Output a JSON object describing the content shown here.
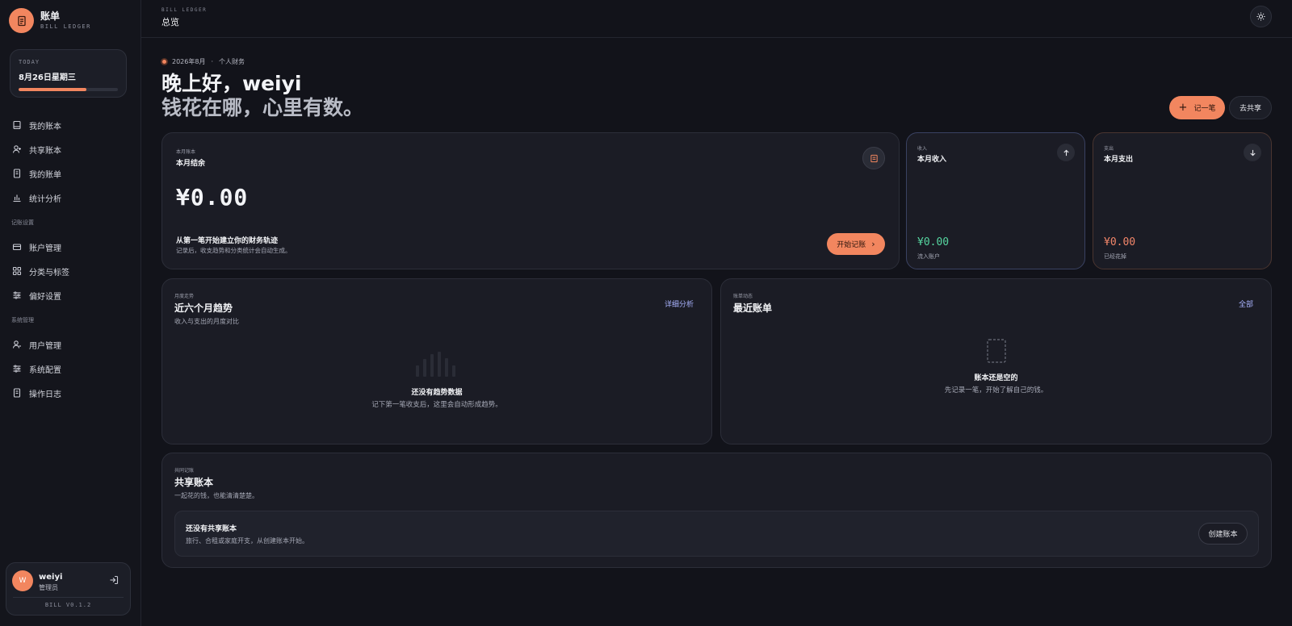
{
  "brand": {
    "title": "账单",
    "subtitle": "BILL LEDGER"
  },
  "today": {
    "label": "TODAY",
    "date": "8月26日星期三",
    "progress": 0.68
  },
  "nav": {
    "main": [
      {
        "label": "我的账本",
        "icon": "book-icon"
      },
      {
        "label": "共享账本",
        "icon": "user-plus-icon"
      },
      {
        "label": "我的账单",
        "icon": "receipt-icon"
      },
      {
        "label": "统计分析",
        "icon": "bar-chart-icon"
      }
    ],
    "section_settings": "记账设置",
    "settings": [
      {
        "label": "账户管理",
        "icon": "wallet-icon"
      },
      {
        "label": "分类与标签",
        "icon": "grid-icon"
      },
      {
        "label": "偏好设置",
        "icon": "sliders-icon"
      }
    ],
    "section_system": "系统管理",
    "system": [
      {
        "label": "用户管理",
        "icon": "user-admin-icon"
      },
      {
        "label": "系统配置",
        "icon": "sliders-icon"
      },
      {
        "label": "操作日志",
        "icon": "log-icon"
      }
    ]
  },
  "user": {
    "initial": "W",
    "name": "weiyi",
    "role": "管理员",
    "version": "BILL V0.1.2"
  },
  "topbar": {
    "subtitle": "BILL LEDGER",
    "title": "总览"
  },
  "hero": {
    "period": "2026年8月",
    "scope": "个人财务",
    "greeting": "晚上好，weiyi",
    "slogan": "钱花在哪，心里有数。",
    "add_label": "记一笔",
    "share_label": "去共享"
  },
  "balance": {
    "eyebrow": "本月账本",
    "title": "本月结余",
    "amount": "¥0.00",
    "hint_title": "从第一笔开始建立你的财务轨迹",
    "hint_sub": "记录后，收支趋势和分类统计会自动生成。",
    "start_label": "开始记账"
  },
  "income": {
    "eyebrow": "收入",
    "title": "本月收入",
    "amount": "¥0.00",
    "caption": "流入账户",
    "color": "#56d6a0"
  },
  "expense": {
    "eyebrow": "支出",
    "title": "本月支出",
    "amount": "¥0.00",
    "caption": "已经花掉",
    "color": "#f2866a"
  },
  "trend": {
    "eyebrow": "月度走势",
    "title": "近六个月趋势",
    "sub": "收入与支出的月度对比",
    "link": "详细分析",
    "empty_title": "还没有趋势数据",
    "empty_sub": "记下第一笔收支后，这里会自动形成趋势。"
  },
  "recent": {
    "eyebrow": "账单动态",
    "title": "最近账单",
    "link": "全部",
    "empty_title": "账本还是空的",
    "empty_sub": "先记录一笔，开始了解自己的钱。"
  },
  "shared": {
    "eyebrow": "共同记账",
    "title": "共享账本",
    "sub": "一起花的钱，也能清清楚楚。",
    "empty_title": "还没有共享账本",
    "empty_sub": "旅行、合租或家庭开支，从创建账本开始。",
    "create_label": "创建账本"
  },
  "colors": {
    "accent": "#f2865f",
    "link": "#aab4ff",
    "background": "#12131a"
  }
}
